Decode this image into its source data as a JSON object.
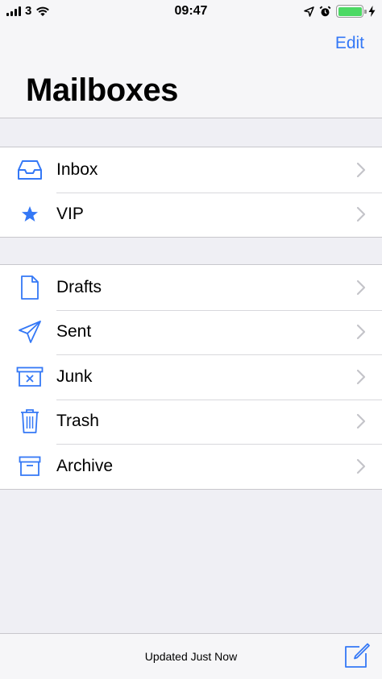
{
  "status_bar": {
    "carrier": "3",
    "time": "09:47",
    "battery_level": 1.0
  },
  "nav": {
    "edit_label": "Edit",
    "title": "Mailboxes"
  },
  "groups": [
    {
      "items": [
        {
          "label": "Inbox",
          "icon": "inbox-icon"
        },
        {
          "label": "VIP",
          "icon": "star-icon"
        }
      ]
    },
    {
      "items": [
        {
          "label": "Drafts",
          "icon": "draft-document-icon"
        },
        {
          "label": "Sent",
          "icon": "paper-plane-icon"
        },
        {
          "label": "Junk",
          "icon": "junk-bin-icon"
        },
        {
          "label": "Trash",
          "icon": "trash-icon"
        },
        {
          "label": "Archive",
          "icon": "archive-box-icon"
        }
      ]
    }
  ],
  "toolbar": {
    "status": "Updated Just Now",
    "compose_icon": "compose-icon"
  },
  "colors": {
    "accent": "#3478f6",
    "battery": "#4cd964",
    "background": "#efeff4"
  }
}
